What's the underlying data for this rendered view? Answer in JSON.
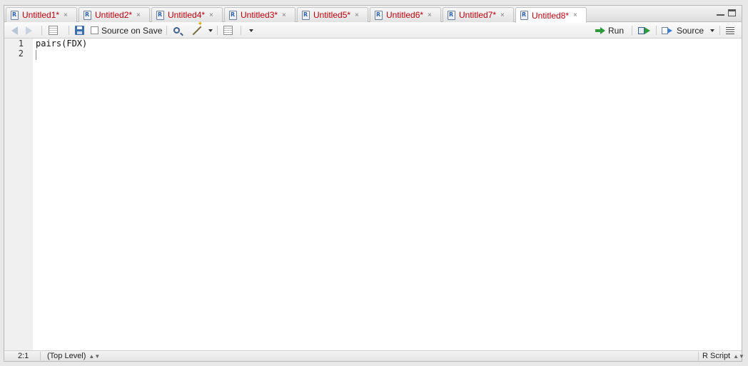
{
  "tabs": [
    {
      "label": "Untitled1*"
    },
    {
      "label": "Untitled2*"
    },
    {
      "label": "Untitled4*"
    },
    {
      "label": "Untitled3*"
    },
    {
      "label": "Untitled5*"
    },
    {
      "label": "Untitled6*"
    },
    {
      "label": "Untitled7*"
    },
    {
      "label": "Untitled8*",
      "active": true
    }
  ],
  "tab_close_glyph": "×",
  "toolbar": {
    "source_on_save": "Source on Save",
    "run": "Run",
    "source": "Source"
  },
  "editor": {
    "line_numbers": [
      "1",
      "2"
    ],
    "lines": [
      "pairs(FDX)",
      ""
    ]
  },
  "status": {
    "position": "2:1",
    "scope": "(Top Level)",
    "file_type": "R Script"
  },
  "colors": {
    "modified_tab_text": "#c0000c",
    "run_green": "#2e9a3c"
  }
}
